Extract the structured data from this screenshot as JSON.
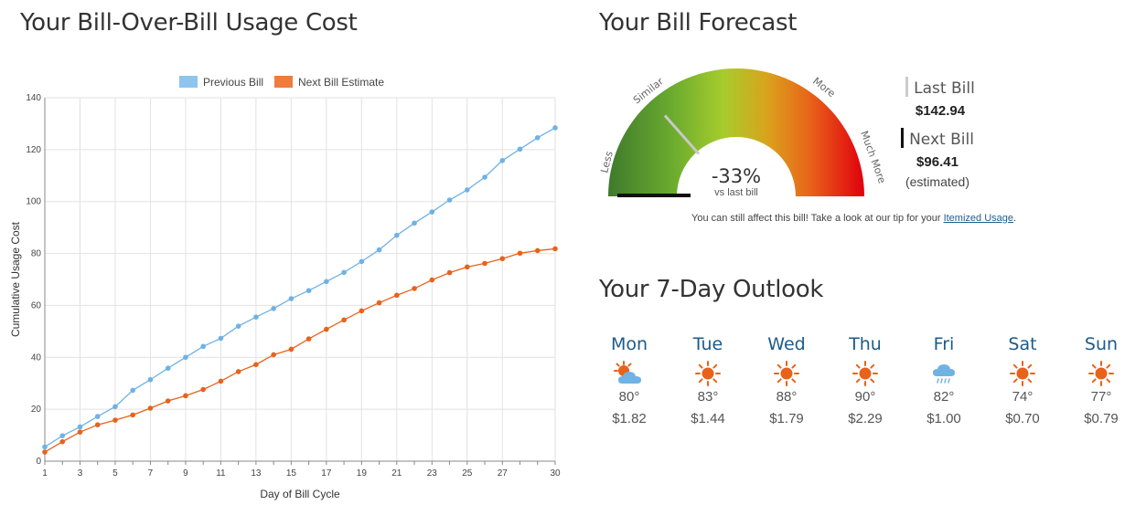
{
  "usage": {
    "title": "Your Bill-Over-Bill Usage Cost"
  },
  "chart_data": {
    "type": "line",
    "xlabel": "Day of Bill Cycle",
    "ylabel": "Cumulative Usage Cost",
    "xlim": [
      1,
      30
    ],
    "ylim": [
      0,
      140
    ],
    "x_ticks": [
      1,
      3,
      5,
      7,
      9,
      11,
      13,
      15,
      17,
      19,
      21,
      23,
      25,
      27,
      30
    ],
    "y_ticks": [
      0,
      20,
      40,
      60,
      80,
      100,
      120,
      140
    ],
    "grid": true,
    "legend_position": "top",
    "x": [
      1,
      2,
      3,
      4,
      5,
      6,
      7,
      8,
      9,
      10,
      11,
      12,
      13,
      14,
      15,
      16,
      17,
      18,
      19,
      20,
      21,
      22,
      23,
      24,
      25,
      26,
      27,
      28,
      29,
      30
    ],
    "series": [
      {
        "name": "Previous Bill",
        "color": "#6fb2e4",
        "legend_color": "#8ec5ee",
        "values": [
          5.5,
          9.8,
          13.2,
          17.2,
          21,
          27.3,
          31.4,
          35.8,
          40,
          44.2,
          47.3,
          52,
          55.5,
          58.8,
          62.6,
          65.7,
          69.2,
          72.7,
          76.9,
          81.4,
          87,
          91.7,
          96,
          100.6,
          104.5,
          109.4,
          115.8,
          120.2,
          124.6,
          128.4
        ]
      },
      {
        "name": "Next Bill Estimate",
        "color": "#e8621a",
        "legend_color": "#ef7b3c",
        "values": [
          3.5,
          7.5,
          11.2,
          14,
          15.8,
          17.8,
          20.4,
          23.2,
          25.2,
          27.6,
          30.8,
          34.5,
          37.2,
          41,
          43.1,
          47.1,
          50.8,
          54.4,
          57.9,
          61,
          63.9,
          66.5,
          69.8,
          72.6,
          74.8,
          76.2,
          78,
          80.1,
          81.1,
          81.8
        ]
      }
    ]
  },
  "forecast": {
    "title": "Your Bill Forecast",
    "gauge": {
      "labels": {
        "less": "Less",
        "similar": "Similar",
        "more": "More",
        "much_more": "Much More"
      },
      "percent": "-33%",
      "subtext": "vs last bill",
      "needle_fraction": 0.27
    },
    "last_bill_label": "Last Bill",
    "last_bill_amount": "$142.94",
    "next_bill_label": "Next Bill",
    "next_bill_amount": "$96.41",
    "next_bill_note": "(estimated)",
    "tip_text": "You can still affect this bill! Take a look at our tip for your ",
    "tip_link": "Itemized Usage",
    "tip_end": "."
  },
  "outlook": {
    "title": "Your 7-Day Outlook",
    "days": [
      {
        "name": "Mon",
        "icon": "partly-cloudy-icon",
        "temp": "80°",
        "cost": "$1.82"
      },
      {
        "name": "Tue",
        "icon": "sun-icon",
        "temp": "83°",
        "cost": "$1.44"
      },
      {
        "name": "Wed",
        "icon": "sun-icon",
        "temp": "88°",
        "cost": "$1.79"
      },
      {
        "name": "Thu",
        "icon": "sun-icon",
        "temp": "90°",
        "cost": "$2.29"
      },
      {
        "name": "Fri",
        "icon": "rain-cloud-icon",
        "temp": "82°",
        "cost": "$1.00"
      },
      {
        "name": "Sat",
        "icon": "sun-icon",
        "temp": "74°",
        "cost": "$0.70"
      },
      {
        "name": "Sun",
        "icon": "sun-icon",
        "temp": "77°",
        "cost": "$0.79"
      }
    ]
  }
}
